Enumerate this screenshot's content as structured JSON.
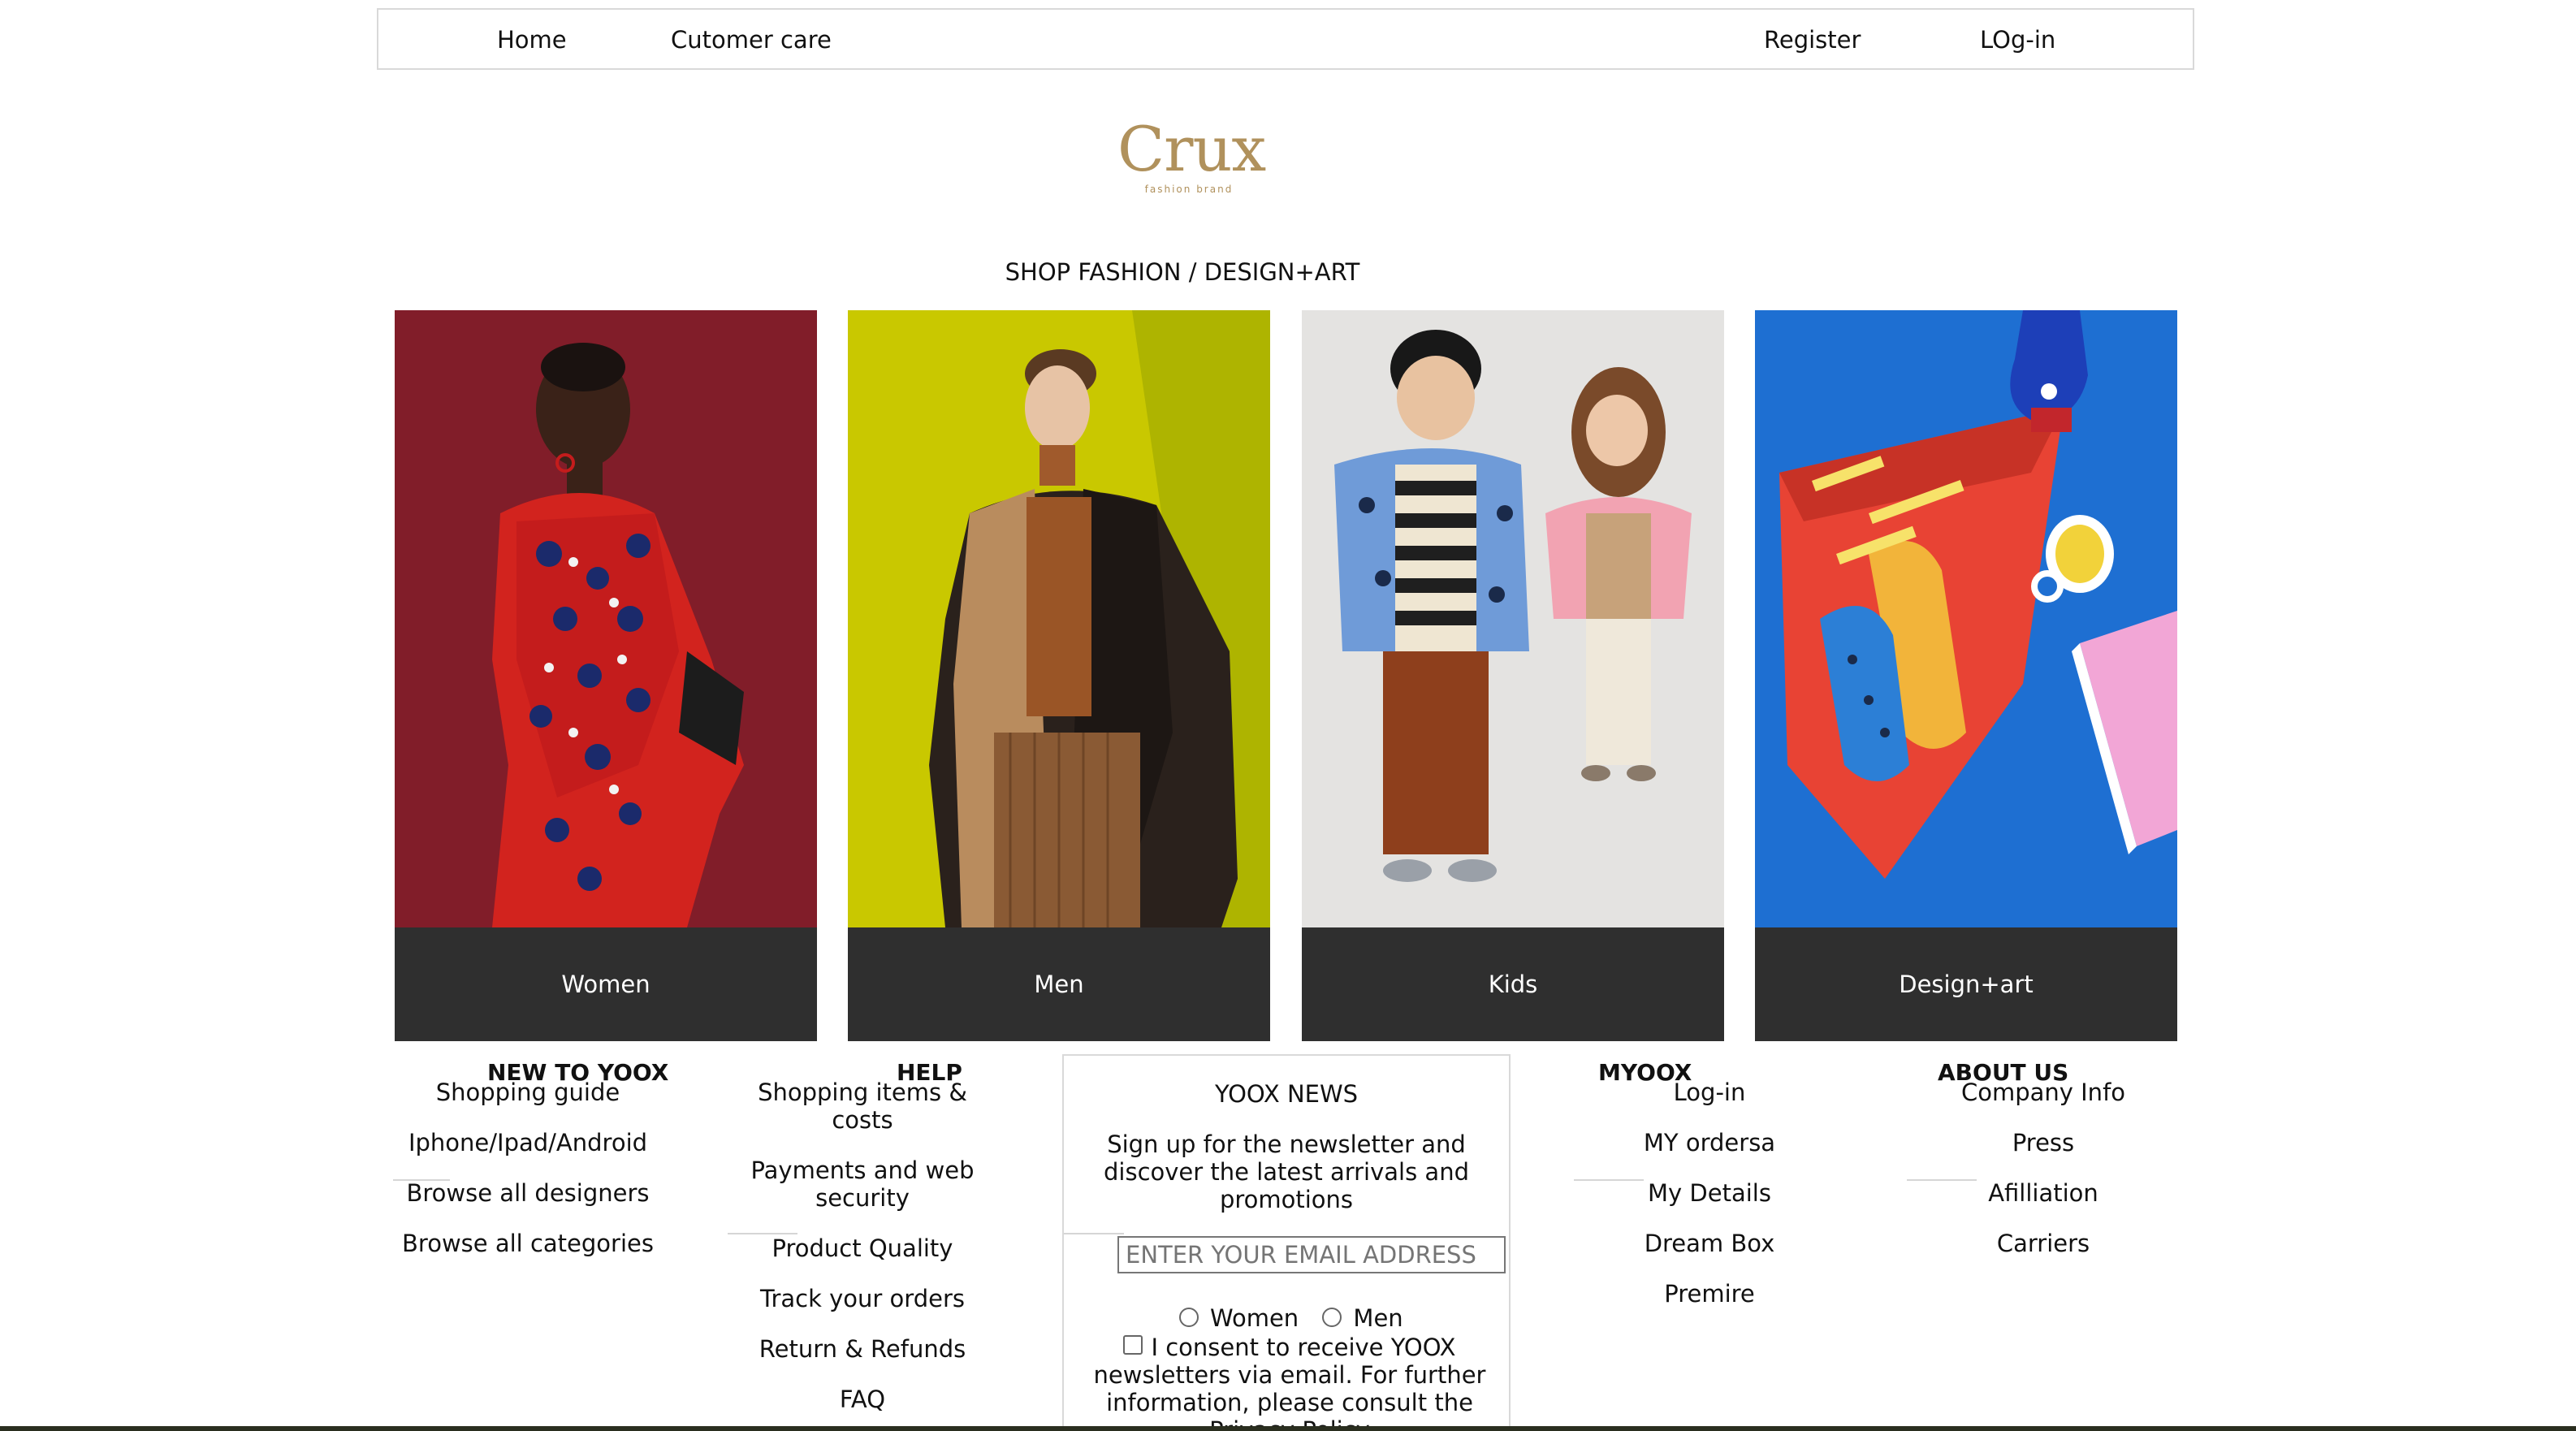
{
  "nav": {
    "home": "Home",
    "customer_care": "Cutomer care",
    "register": "Register",
    "login": "LOg-in"
  },
  "logo": {
    "word": "Crux",
    "sub": "fashion brand"
  },
  "shop_title": "SHOP FASHION / DESIGN+ART",
  "categories": [
    {
      "label": "Women"
    },
    {
      "label": "Men"
    },
    {
      "label": "Kids"
    },
    {
      "label": "Design+art"
    }
  ],
  "footer": {
    "new_to_yoox": {
      "heading": "NEW TO YOOX",
      "links": [
        "Shopping guide",
        "Iphone/Ipad/Android",
        "Browse all designers",
        "Browse all categories"
      ]
    },
    "help": {
      "heading": "HELP",
      "links": [
        "Shopping items & costs",
        "Payments and web security",
        "Product Quality",
        "Track your orders",
        "Return & Refunds",
        "FAQ"
      ]
    },
    "news": {
      "title": "YOOX NEWS",
      "text": "Sign up for the newsletter and discover the latest arrivals and promotions",
      "email_placeholder": "ENTER YOUR EMAIL ADDRESS",
      "women": "Women",
      "men": "Men",
      "consent": "I consent to receive YOOX newsletters via email. For further information, please consult the Privacy Policy"
    },
    "myoox": {
      "heading": "MYOOX",
      "links": [
        "Log-in",
        "MY ordersa",
        "My Details",
        "Dream Box",
        "Premire"
      ]
    },
    "about": {
      "heading": "ABOUT US",
      "links": [
        "Company Info",
        "Press",
        "Afilliation",
        "Carriers"
      ]
    }
  },
  "colors": {
    "brand_gold": "#b0915c",
    "caption_bg": "#2f2f2f"
  }
}
